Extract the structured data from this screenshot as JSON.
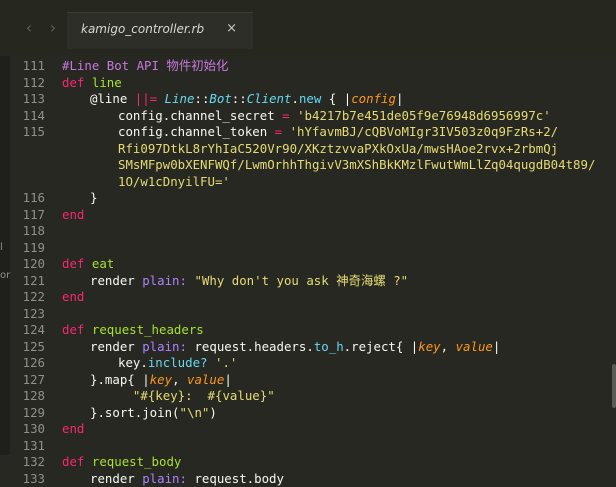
{
  "tab": {
    "title": "kamigo_controller.rb",
    "close_glyph": "×"
  },
  "nav": {
    "back_glyph": "‹",
    "forward_glyph": "›"
  },
  "edge_marks": [
    "l",
    "or"
  ],
  "lines": [
    {
      "n": "111",
      "indent": 1,
      "tokens": [
        [
          "comment",
          "#Line Bot API 物件初始化"
        ]
      ]
    },
    {
      "n": "112",
      "indent": 1,
      "tokens": [
        [
          "kw",
          "def"
        ],
        [
          "plain",
          " "
        ],
        [
          "fn",
          "line"
        ]
      ]
    },
    {
      "n": "113",
      "indent": 2,
      "tokens": [
        [
          "ivar",
          "@line"
        ],
        [
          "plain",
          " "
        ],
        [
          "op",
          "||="
        ],
        [
          "plain",
          " "
        ],
        [
          "cls",
          "Line"
        ],
        [
          "plain",
          "::"
        ],
        [
          "cls",
          "Bot"
        ],
        [
          "plain",
          "::"
        ],
        [
          "cls",
          "Client"
        ],
        [
          "plain",
          "."
        ],
        [
          "meth",
          "new"
        ],
        [
          "plain",
          " { |"
        ],
        [
          "param",
          "config"
        ],
        [
          "plain",
          "|"
        ]
      ]
    },
    {
      "n": "114",
      "indent": 3,
      "tokens": [
        [
          "plain",
          "config.channel_secret "
        ],
        [
          "op",
          "="
        ],
        [
          "plain",
          " "
        ],
        [
          "str",
          "'b4217b7e451de05f9e76948d6956997c'"
        ]
      ]
    },
    {
      "n": "115",
      "indent": 3,
      "tokens": [
        [
          "plain",
          "config.channel_token "
        ],
        [
          "op",
          "="
        ],
        [
          "plain",
          " "
        ],
        [
          "str",
          "'hYfavmBJ/cQBVoMIgr3IV503z0q9FzRs+2/"
        ]
      ]
    },
    {
      "n": "",
      "indent": 3,
      "tokens": [
        [
          "str",
          "Rfi097DtkL8rYhIaC520Vr90/XKztzvvaPXkOxUa/mwsHAoe2rvx+2rbmQj"
        ]
      ]
    },
    {
      "n": "",
      "indent": 3,
      "tokens": [
        [
          "str",
          "SMsMFpw0bXENFWQf/LwmOrhhThgivV3mXShBkKMzlFwutWmLlZq04qugdB04t89/"
        ]
      ]
    },
    {
      "n": "",
      "indent": 3,
      "tokens": [
        [
          "str",
          "1O/w1cDnyilFU='"
        ]
      ]
    },
    {
      "n": "116",
      "indent": 2,
      "tokens": [
        [
          "plain",
          "}"
        ]
      ]
    },
    {
      "n": "117",
      "indent": 1,
      "tokens": [
        [
          "kw",
          "end"
        ]
      ]
    },
    {
      "n": "118",
      "indent": 0,
      "tokens": []
    },
    {
      "n": "119",
      "indent": 0,
      "tokens": []
    },
    {
      "n": "120",
      "indent": 1,
      "tokens": [
        [
          "kw",
          "def"
        ],
        [
          "plain",
          " "
        ],
        [
          "fn",
          "eat"
        ]
      ]
    },
    {
      "n": "121",
      "indent": 2,
      "tokens": [
        [
          "plain",
          "render "
        ],
        [
          "sym",
          "plain:"
        ],
        [
          "plain",
          " "
        ],
        [
          "str",
          "\"Why don't you ask 神奇海螺 ?\""
        ]
      ]
    },
    {
      "n": "122",
      "indent": 1,
      "tokens": [
        [
          "kw",
          "end"
        ]
      ]
    },
    {
      "n": "123",
      "indent": 0,
      "tokens": []
    },
    {
      "n": "124",
      "indent": 1,
      "tokens": [
        [
          "kw",
          "def"
        ],
        [
          "plain",
          " "
        ],
        [
          "fn",
          "request_headers"
        ]
      ]
    },
    {
      "n": "125",
      "indent": 2,
      "tokens": [
        [
          "plain",
          "render "
        ],
        [
          "sym",
          "plain:"
        ],
        [
          "plain",
          " request.headers."
        ],
        [
          "meth",
          "to_h"
        ],
        [
          "plain",
          ".reject{ |"
        ],
        [
          "param",
          "key"
        ],
        [
          "plain",
          ", "
        ],
        [
          "param",
          "value"
        ],
        [
          "plain",
          "|"
        ]
      ]
    },
    {
      "n": "126",
      "indent": 3,
      "tokens": [
        [
          "plain",
          "key."
        ],
        [
          "meth",
          "include?"
        ],
        [
          "plain",
          " "
        ],
        [
          "str",
          "'.'"
        ]
      ]
    },
    {
      "n": "127",
      "indent": 2,
      "tokens": [
        [
          "plain",
          "}.map{ |"
        ],
        [
          "param",
          "key"
        ],
        [
          "plain",
          ", "
        ],
        [
          "param",
          "value"
        ],
        [
          "plain",
          "|"
        ]
      ]
    },
    {
      "n": "128",
      "indent": 3,
      "tokens": [
        [
          "plain",
          "  "
        ],
        [
          "str",
          "\"#{key}:  #{value}\""
        ]
      ]
    },
    {
      "n": "129",
      "indent": 2,
      "tokens": [
        [
          "plain",
          "}.sort.join("
        ],
        [
          "str",
          "\"\\n\""
        ],
        [
          "plain",
          ")"
        ]
      ]
    },
    {
      "n": "130",
      "indent": 1,
      "tokens": [
        [
          "kw",
          "end"
        ]
      ]
    },
    {
      "n": "131",
      "indent": 0,
      "tokens": []
    },
    {
      "n": "132",
      "indent": 1,
      "tokens": [
        [
          "kw",
          "def"
        ],
        [
          "plain",
          " "
        ],
        [
          "fn",
          "request_body"
        ]
      ]
    },
    {
      "n": "133",
      "indent": 2,
      "tokens": [
        [
          "plain",
          "render "
        ],
        [
          "sym",
          "plain:"
        ],
        [
          "plain",
          " request.body"
        ]
      ]
    }
  ],
  "line_number_overrides": [
    "111",
    "112",
    "113",
    "114",
    "115",
    "",
    "",
    "",
    "116",
    "117",
    "118",
    "119",
    "120",
    "121",
    "122",
    "123",
    "124",
    "125",
    "126",
    "127",
    "128",
    "129",
    "130",
    "131",
    "132",
    "133"
  ]
}
